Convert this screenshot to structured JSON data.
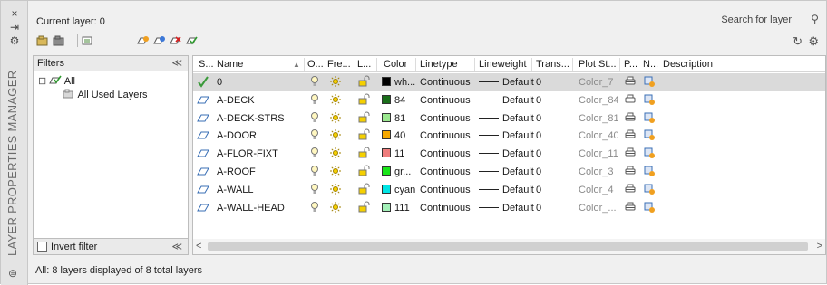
{
  "window": {
    "title": "LAYER PROPERTIES MANAGER"
  },
  "sidebar": {
    "close": "×",
    "pin": "⇥",
    "settings": "⚙",
    "footer": "⊜"
  },
  "toolbar": {
    "current_layer": "Current layer: 0"
  },
  "search": {
    "placeholder": "Search for layer"
  },
  "filters": {
    "header": "Filters",
    "collapse": "≪",
    "tree": [
      {
        "label": "All",
        "toggle": "⊟"
      },
      {
        "label": "All Used Layers"
      }
    ],
    "invert_label": "Invert filter"
  },
  "grid": {
    "columns": [
      {
        "label": "S..."
      },
      {
        "label": "Name",
        "sort": "▲"
      },
      {
        "label": "O..."
      },
      {
        "label": "Fre..."
      },
      {
        "label": "L..."
      },
      {
        "label": "Color"
      },
      {
        "label": "Linetype"
      },
      {
        "label": "Lineweight"
      },
      {
        "label": "Trans..."
      },
      {
        "label": "Plot St..."
      },
      {
        "label": "P..."
      },
      {
        "label": "N..."
      },
      {
        "label": "Description"
      }
    ],
    "rows": [
      {
        "status": "current",
        "name": "0",
        "color_hex": "#000000",
        "color_name": "wh...",
        "linetype": "Continuous",
        "lineweight": "Default",
        "transparency": "0",
        "plot_style": "Color_7",
        "selected": true
      },
      {
        "status": "layer",
        "name": "A-DECK",
        "color_hex": "#1a6e1a",
        "color_name": "84",
        "linetype": "Continuous",
        "lineweight": "Default",
        "transparency": "0",
        "plot_style": "Color_84"
      },
      {
        "status": "layer",
        "name": "A-DECK-STRS",
        "color_hex": "#9be88f",
        "color_name": "81",
        "linetype": "Continuous",
        "lineweight": "Default",
        "transparency": "0",
        "plot_style": "Color_81"
      },
      {
        "status": "layer",
        "name": "A-DOOR",
        "color_hex": "#f5a800",
        "color_name": "40",
        "linetype": "Continuous",
        "lineweight": "Default",
        "transparency": "0",
        "plot_style": "Color_40"
      },
      {
        "status": "layer",
        "name": "A-FLOR-FIXT",
        "color_hex": "#ef7d7d",
        "color_name": "11",
        "linetype": "Continuous",
        "lineweight": "Default",
        "transparency": "0",
        "plot_style": "Color_11"
      },
      {
        "status": "layer",
        "name": "A-ROOF",
        "color_hex": "#19e619",
        "color_name": "gr...",
        "linetype": "Continuous",
        "lineweight": "Default",
        "transparency": "0",
        "plot_style": "Color_3"
      },
      {
        "status": "layer",
        "name": "A-WALL",
        "color_hex": "#00e5e5",
        "color_name": "cyan",
        "linetype": "Continuous",
        "lineweight": "Default",
        "transparency": "0",
        "plot_style": "Color_4"
      },
      {
        "status": "layer",
        "name": "A-WALL-HEAD",
        "color_hex": "#a3f0b8",
        "color_name": "111",
        "linetype": "Continuous",
        "lineweight": "Default",
        "transparency": "0",
        "plot_style": "Color_..."
      }
    ]
  },
  "scroll": {
    "left": "<",
    "right": ">"
  },
  "status_bar": "All: 8 layers displayed of 8 total layers",
  "icons": {
    "on": "lightbulb-icon",
    "freeze": "sun-icon",
    "lock": "unlock-icon",
    "plot": "printer-icon",
    "newvp": "new-vp-freeze-icon",
    "current": "check-icon",
    "layer": "layer-parallelogram-icon"
  }
}
